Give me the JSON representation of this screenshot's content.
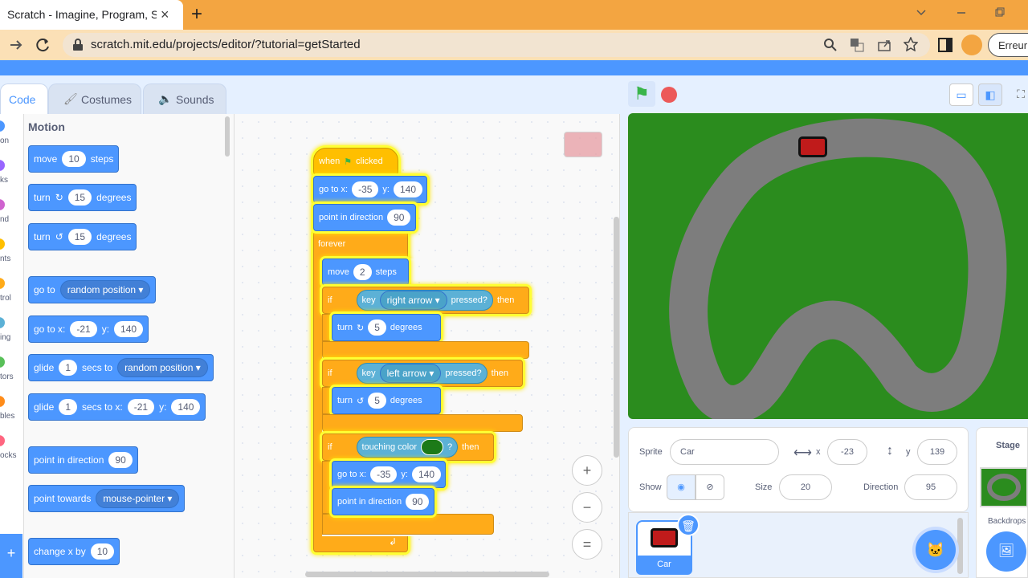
{
  "browser": {
    "tab_title": "Scratch - Imagine, Program, Shar",
    "close_icon": "×",
    "new_tab_icon": "+",
    "url": "scratch.mit.edu/projects/editor/?tutorial=getStarted",
    "profile_button": "Erreur"
  },
  "tabs": {
    "code": "Code",
    "costumes": "Costumes",
    "sounds": "Sounds"
  },
  "categories": [
    {
      "label": "on",
      "color": "#4c97ff"
    },
    {
      "label": "ks",
      "color": "#9966ff"
    },
    {
      "label": "nd",
      "color": "#cf63cf"
    },
    {
      "label": "nts",
      "color": "#ffbf00"
    },
    {
      "label": "trol",
      "color": "#ffab19"
    },
    {
      "label": "ing",
      "color": "#5cb1d6"
    },
    {
      "label": "tors",
      "color": "#59c059"
    },
    {
      "label": "bles",
      "color": "#ff8c1a"
    },
    {
      "label": "ocks",
      "color": "#ff6680"
    }
  ],
  "palette": {
    "title": "Motion",
    "blocks": {
      "move": {
        "a": "move",
        "n": "10",
        "b": "steps"
      },
      "turn_cw": {
        "a": "turn",
        "n": "15",
        "b": "degrees"
      },
      "turn_ccw": {
        "a": "turn",
        "n": "15",
        "b": "degrees"
      },
      "goto": {
        "a": "go to",
        "d": "random position"
      },
      "gotoxy": {
        "a": "go to x:",
        "x": "-21",
        "b": "y:",
        "y": "140"
      },
      "glide": {
        "a": "glide",
        "n": "1",
        "b": "secs to",
        "d": "random position"
      },
      "glidexy": {
        "a": "glide",
        "n": "1",
        "b": "secs to x:",
        "x": "-21",
        "c": "y:",
        "y": "140"
      },
      "pointdir": {
        "a": "point in direction",
        "n": "90"
      },
      "pointtowards": {
        "a": "point towards",
        "d": "mouse-pointer"
      },
      "changex": {
        "a": "change x by",
        "n": "10"
      }
    }
  },
  "script": {
    "when": "when",
    "clicked": "clicked",
    "goto": {
      "a": "go to x:",
      "x": "-35",
      "b": "y:",
      "y": "140"
    },
    "pointdir": {
      "a": "point in direction",
      "n": "90"
    },
    "forever": "forever",
    "move": {
      "a": "move",
      "n": "2",
      "b": "steps"
    },
    "if1": {
      "if": "if",
      "key": "key",
      "d": "right arrow",
      "p": "pressed?",
      "then": "then"
    },
    "turn1": {
      "a": "turn",
      "n": "5",
      "b": "degrees"
    },
    "if2": {
      "if": "if",
      "key": "key",
      "d": "left arrow",
      "p": "pressed?",
      "then": "then"
    },
    "turn2": {
      "a": "turn",
      "n": "5",
      "b": "degrees"
    },
    "if3": {
      "if": "if",
      "t": "touching color",
      "q": "?",
      "then": "then"
    },
    "goto2": {
      "a": "go to x:",
      "x": "-35",
      "b": "y:",
      "y": "140"
    },
    "pointdir2": {
      "a": "point in direction",
      "n": "90"
    }
  },
  "zoom": {
    "in": "+",
    "out": "−",
    "reset": "="
  },
  "sprite_info": {
    "sprite_label": "Sprite",
    "sprite_name": "Car",
    "x_label": "x",
    "x": "-23",
    "y_label": "y",
    "y": "139",
    "show_label": "Show",
    "size_label": "Size",
    "size": "20",
    "direction_label": "Direction",
    "direction": "95"
  },
  "sprite_tile": {
    "name": "Car"
  },
  "stage_panel": {
    "title": "Stage",
    "backdrops": "Backdrops"
  },
  "colors": {
    "motion": "#4c97ff",
    "events": "#ffbf00",
    "control": "#ffab19",
    "sensing": "#5cb1d6",
    "stage_grass": "#2b8c1e",
    "track": "#7d7d7d"
  }
}
